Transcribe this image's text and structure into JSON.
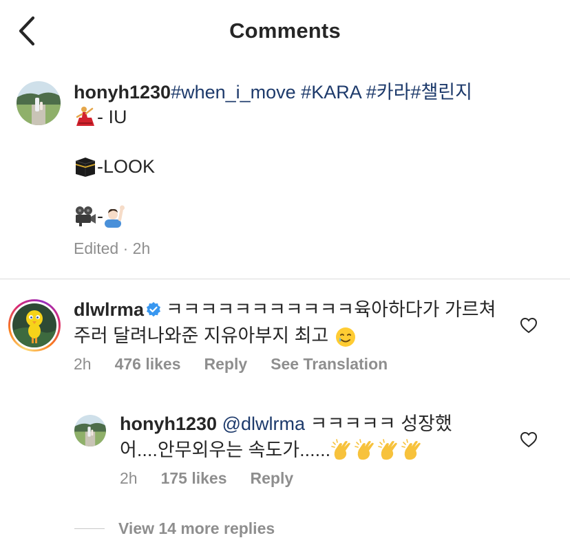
{
  "header": {
    "title": "Comments",
    "back_icon": "chevron-left-icon"
  },
  "caption": {
    "username": "honyh1230",
    "hashtags": " #when_i_move #KARA #카라#챌린지",
    "lines": [
      {
        "emoji": "dancer-icon",
        "text": " - IU"
      },
      {
        "emoji": "kaaba-icon",
        "text": "-LOOK"
      },
      {
        "emoji": "movie-camera-icon",
        "text": "-",
        "emoji2": "man-raising-hand-icon"
      }
    ],
    "meta": "Edited · 2h"
  },
  "comments": [
    {
      "username": "dlwlrma",
      "verified": true,
      "text_line1": "ㅋㅋㅋㅋㅋㅋㅋㅋㅋㅋㅋ육아하다가 가르쳐",
      "text_line2": "주러 달려나와준 지유아부지 최고 ",
      "emoji": "smiling-face-with-tear-icon",
      "time": "2h",
      "likes": "476 likes",
      "reply": "Reply",
      "translate": "See Translation"
    }
  ],
  "reply": {
    "username": "honyh1230",
    "mention": "@dlwlrma",
    "text_line1": " ㅋㅋㅋㅋㅋ 성장했",
    "text_line2": "어....안무외우는 속도가......",
    "emoji": "clapping-hands-icon",
    "time": "2h",
    "likes": "175 likes",
    "reply": "Reply"
  },
  "view_more": "View 14 more replies",
  "colors": {
    "text": "#262626",
    "secondary": "#8e8e8e",
    "link": "#1d3a6b",
    "verified": "#3897f0",
    "divider": "#dbdbdb"
  }
}
